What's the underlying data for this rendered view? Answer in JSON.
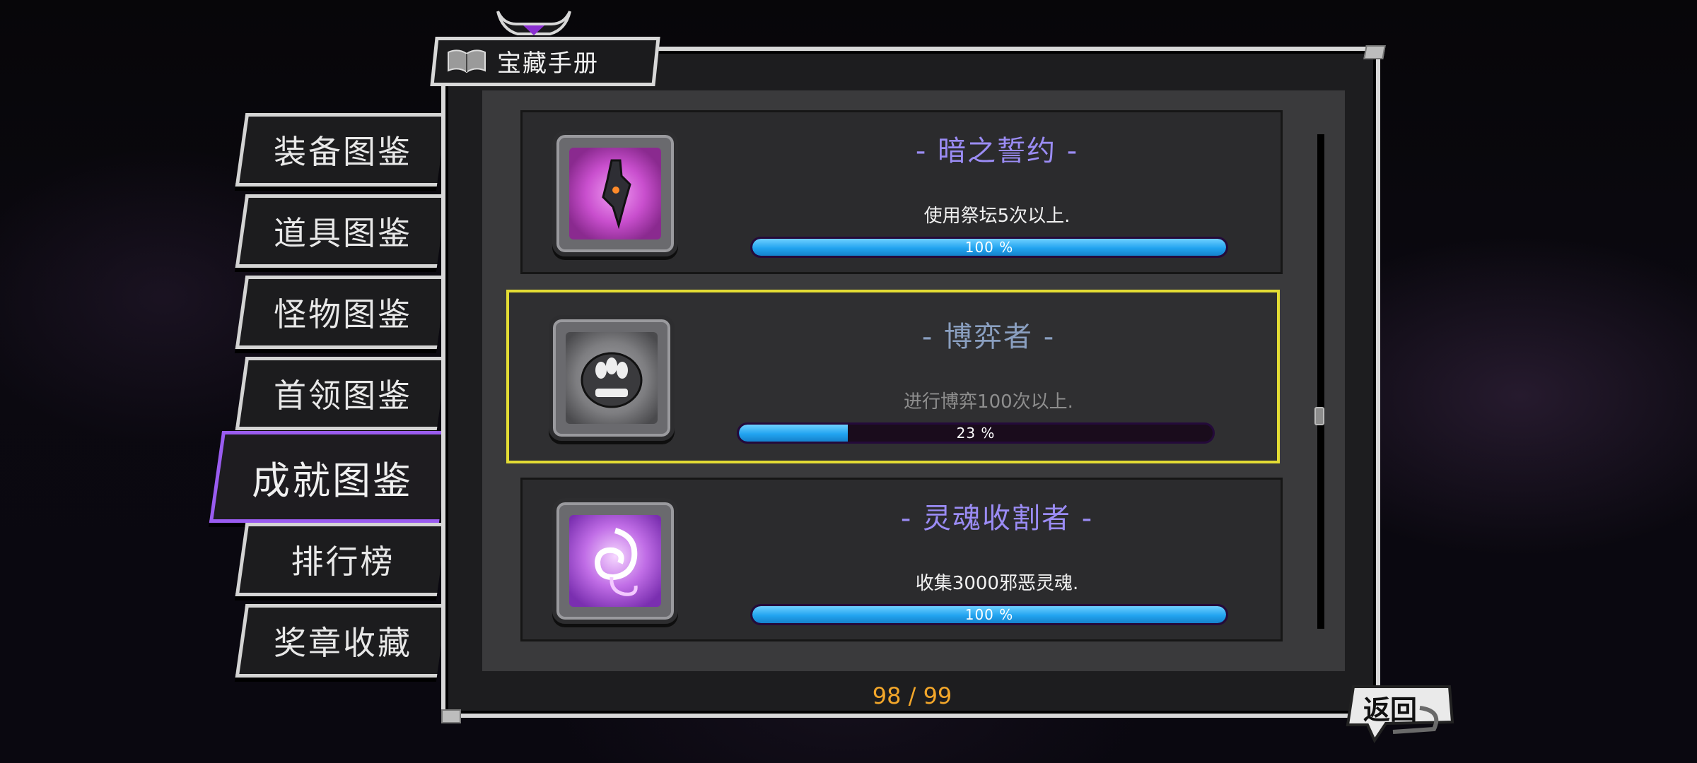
{
  "header": {
    "title": "宝藏手册"
  },
  "tabs": [
    {
      "label": "装备图鉴",
      "active": false
    },
    {
      "label": "道具图鉴",
      "active": false
    },
    {
      "label": "怪物图鉴",
      "active": false
    },
    {
      "label": "首领图鉴",
      "active": false
    },
    {
      "label": "成就图鉴",
      "active": true
    },
    {
      "label": "排行榜",
      "active": false
    },
    {
      "label": "奖章收藏",
      "active": false
    }
  ],
  "achievements": [
    {
      "title": "- 暗之誓约 -",
      "description": "使用祭坛5次以上.",
      "progress": 100,
      "progress_label": "100 %",
      "icon": "dark-oath-icon",
      "title_color": "#9b8cf5",
      "selected": false
    },
    {
      "title": "- 博弈者 -",
      "description": "进行博弈100次以上.",
      "progress": 23,
      "progress_label": "23 %",
      "icon": "gambler-monster-icon",
      "title_color": "#8a9fc0",
      "selected": true
    },
    {
      "title": "- 灵魂收割者 -",
      "description": "收集3000邪恶灵魂.",
      "progress": 100,
      "progress_label": "100 %",
      "icon": "soul-reaper-icon",
      "title_color": "#9b8cf5",
      "selected": false
    }
  ],
  "pagination": {
    "text": "98 / 99"
  },
  "back_button": {
    "label": "返回"
  },
  "colors": {
    "accent": "#9a5cf0",
    "selection": "#e3dc34",
    "progress": "#22a4f0",
    "pager": "#f2a62a"
  }
}
